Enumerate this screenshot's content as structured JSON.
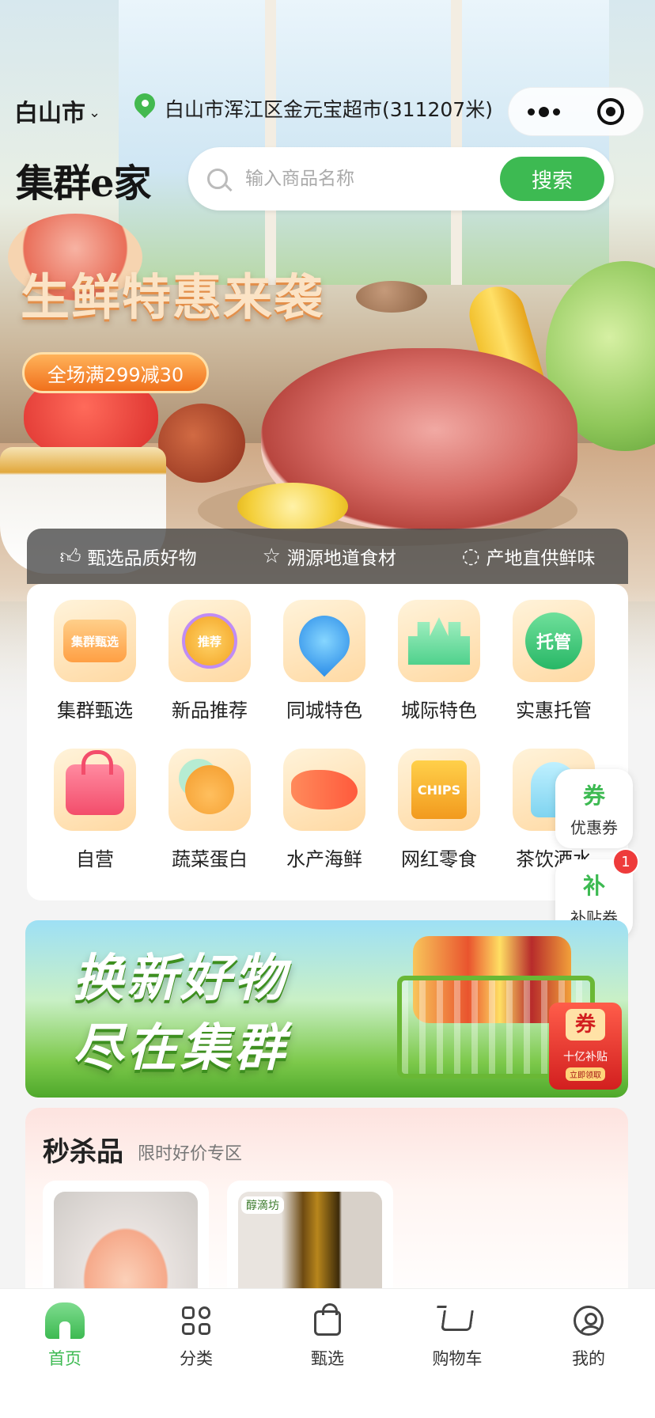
{
  "header": {
    "city": "白山市",
    "location": "白山市浑江区金元宝超市(311207米)",
    "logo": "集群e家",
    "search_placeholder": "输入商品名称",
    "search_button": "搜索"
  },
  "hero": {
    "headline": "生鲜特惠来袭",
    "promo": "全场满299减30"
  },
  "features": [
    {
      "icon": "thumbs-up-icon",
      "label": "甄选品质好物"
    },
    {
      "icon": "star-icon",
      "label": "溯源地道食材"
    },
    {
      "icon": "apple-icon",
      "label": "产地直供鲜味"
    }
  ],
  "categories": [
    {
      "label": "集群甄选",
      "icon_text": "集群甄选"
    },
    {
      "label": "新品推荐",
      "icon_text": "推荐"
    },
    {
      "label": "同城特色",
      "icon_text": ""
    },
    {
      "label": "城际特色",
      "icon_text": ""
    },
    {
      "label": "实惠托管",
      "icon_text": "托管"
    },
    {
      "label": "自营",
      "icon_text": ""
    },
    {
      "label": "蔬菜蛋白",
      "icon_text": ""
    },
    {
      "label": "水产海鲜",
      "icon_text": ""
    },
    {
      "label": "网红零食",
      "icon_text": "CHIPS"
    },
    {
      "label": "茶饮酒水",
      "icon_text": ""
    }
  ],
  "floating": {
    "coupon_icon": "券",
    "coupon_label": "优惠券",
    "subsidy_icon": "补",
    "subsidy_label": "补贴券",
    "subsidy_badge": "1"
  },
  "banner": {
    "line1": "换新好物",
    "line2": "尽在集群",
    "coupon_icon": "券",
    "coupon_text": "十亿补贴",
    "coupon_sub": "立即领取"
  },
  "flash_sale": {
    "title": "秒杀品",
    "subtitle": "限时好价专区",
    "product2_brand": "醇滴坊"
  },
  "tabbar": [
    {
      "label": "首页",
      "active": true
    },
    {
      "label": "分类",
      "active": false
    },
    {
      "label": "甄选",
      "active": false
    },
    {
      "label": "购物车",
      "active": false
    },
    {
      "label": "我的",
      "active": false
    }
  ],
  "colors": {
    "accent": "#3dba52",
    "promo": "#f0701c",
    "badge": "#ee3b3b"
  }
}
